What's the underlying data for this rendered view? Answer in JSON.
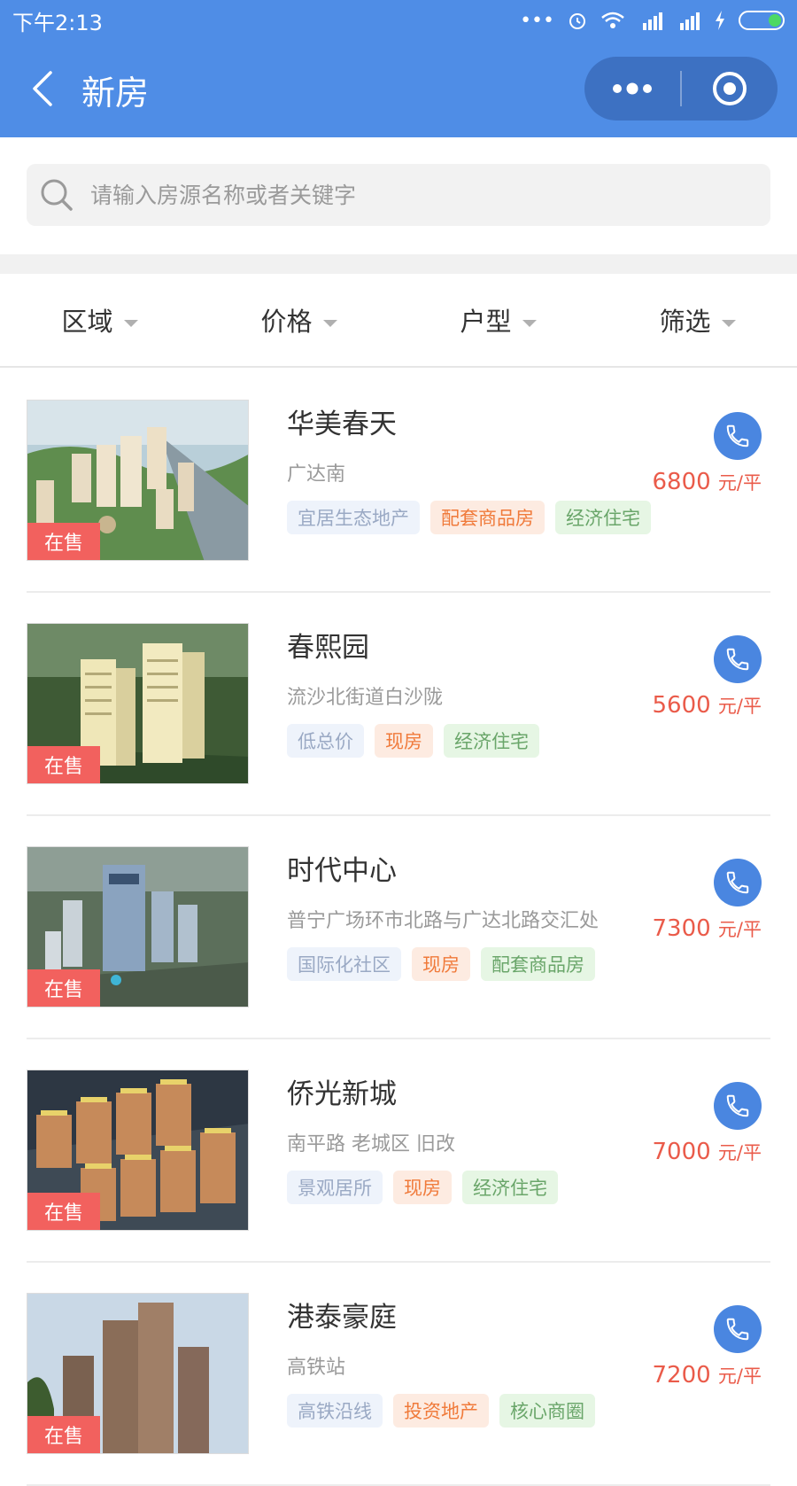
{
  "status_bar": {
    "time": "下午2:13",
    "indicators": [
      "more-dots-icon",
      "alarm-icon",
      "wifi-icon",
      "signal-hd-icon",
      "signal-icon",
      "charging-icon",
      "battery-icon"
    ]
  },
  "nav": {
    "title": "新房",
    "back_icon": "chevron-left-icon",
    "more_icon": "more-dots-icon",
    "target_icon": "record-target-icon"
  },
  "search": {
    "placeholder": "请输入房源名称或者关键字",
    "value": ""
  },
  "filters": [
    {
      "label": "区域"
    },
    {
      "label": "价格"
    },
    {
      "label": "户型"
    },
    {
      "label": "筛选"
    }
  ],
  "listings": [
    {
      "name": "华美春天",
      "address": "广达南",
      "status": "在售",
      "price": "6800",
      "unit": "元/平",
      "tags": [
        {
          "text": "宜居生态地产",
          "color": "blue"
        },
        {
          "text": "配套商品房",
          "color": "orange"
        },
        {
          "text": "经济住宅",
          "color": "green"
        }
      ]
    },
    {
      "name": "春熙园",
      "address": "流沙北街道白沙陇",
      "status": "在售",
      "price": "5600",
      "unit": "元/平",
      "tags": [
        {
          "text": "低总价",
          "color": "blue"
        },
        {
          "text": "现房",
          "color": "orange"
        },
        {
          "text": "经济住宅",
          "color": "green"
        }
      ]
    },
    {
      "name": "时代中心",
      "address": "普宁广场环市北路与广达北路交汇处",
      "status": "在售",
      "price": "7300",
      "unit": "元/平",
      "tags": [
        {
          "text": "国际化社区",
          "color": "blue"
        },
        {
          "text": "现房",
          "color": "orange"
        },
        {
          "text": "配套商品房",
          "color": "green"
        }
      ]
    },
    {
      "name": "侨光新城",
      "address": "南平路 老城区 旧改",
      "status": "在售",
      "price": "7000",
      "unit": "元/平",
      "tags": [
        {
          "text": "景观居所",
          "color": "blue"
        },
        {
          "text": "现房",
          "color": "orange"
        },
        {
          "text": "经济住宅",
          "color": "green"
        }
      ]
    },
    {
      "name": "港泰豪庭",
      "address": "高铁站",
      "status": "在售",
      "price": "7200",
      "unit": "元/平",
      "tags": [
        {
          "text": "高铁沿线",
          "color": "blue"
        },
        {
          "text": "投资地产",
          "color": "orange"
        },
        {
          "text": "核心商圈",
          "color": "green"
        }
      ]
    }
  ],
  "colors": {
    "header_bg": "#4f8de6",
    "price": "#ea5b4a",
    "sale_badge": "#f2615e",
    "phone_button": "#4a86e0"
  }
}
